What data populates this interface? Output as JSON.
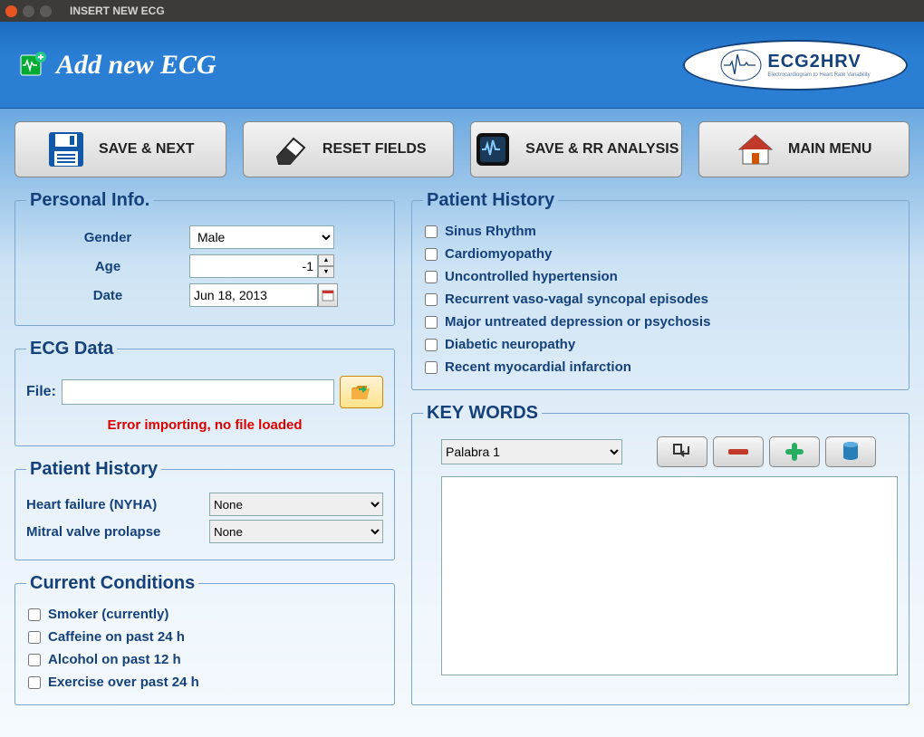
{
  "window": {
    "title": "INSERT NEW ECG"
  },
  "header": {
    "title": "Add new ECG",
    "logo_main": "ECG2HRV",
    "logo_sub": "Electrocardiogram to Heart Rate Variability"
  },
  "toolbar": {
    "save_next": "SAVE & NEXT",
    "reset": "RESET FIELDS",
    "save_rr": "SAVE & RR ANALYSIS",
    "main_menu": "MAIN MENU"
  },
  "personal_info": {
    "legend": "Personal Info.",
    "gender_label": "Gender",
    "gender_value": "Male",
    "age_label": "Age",
    "age_value": "-1",
    "date_label": "Date",
    "date_value": "Jun 18, 2013"
  },
  "ecg_data": {
    "legend": "ECG Data",
    "file_label": "File:",
    "file_value": "",
    "error": "Error importing, no file loaded"
  },
  "patient_history_left": {
    "legend": "Patient History",
    "heart_failure_label": "Heart failure (NYHA)",
    "heart_failure_value": "None",
    "mitral_label": "Mitral valve prolapse",
    "mitral_value": "None"
  },
  "current_conditions": {
    "legend": "Current Conditions",
    "items": [
      "Smoker (currently)",
      "Caffeine on past 24 h",
      "Alcohol on past 12 h",
      "Exercise over past 24 h"
    ]
  },
  "patient_history_right": {
    "legend": "Patient History",
    "items": [
      "Sinus Rhythm",
      "Cardiomyopathy",
      "Uncontrolled hypertension",
      "Recurrent vaso-vagal syncopal episodes",
      "Major untreated depression or psychosis",
      "Diabetic neuropathy",
      "Recent myocardial infarction"
    ]
  },
  "keywords": {
    "legend": "KEY WORDS",
    "selected": "Palabra 1",
    "text": ""
  }
}
